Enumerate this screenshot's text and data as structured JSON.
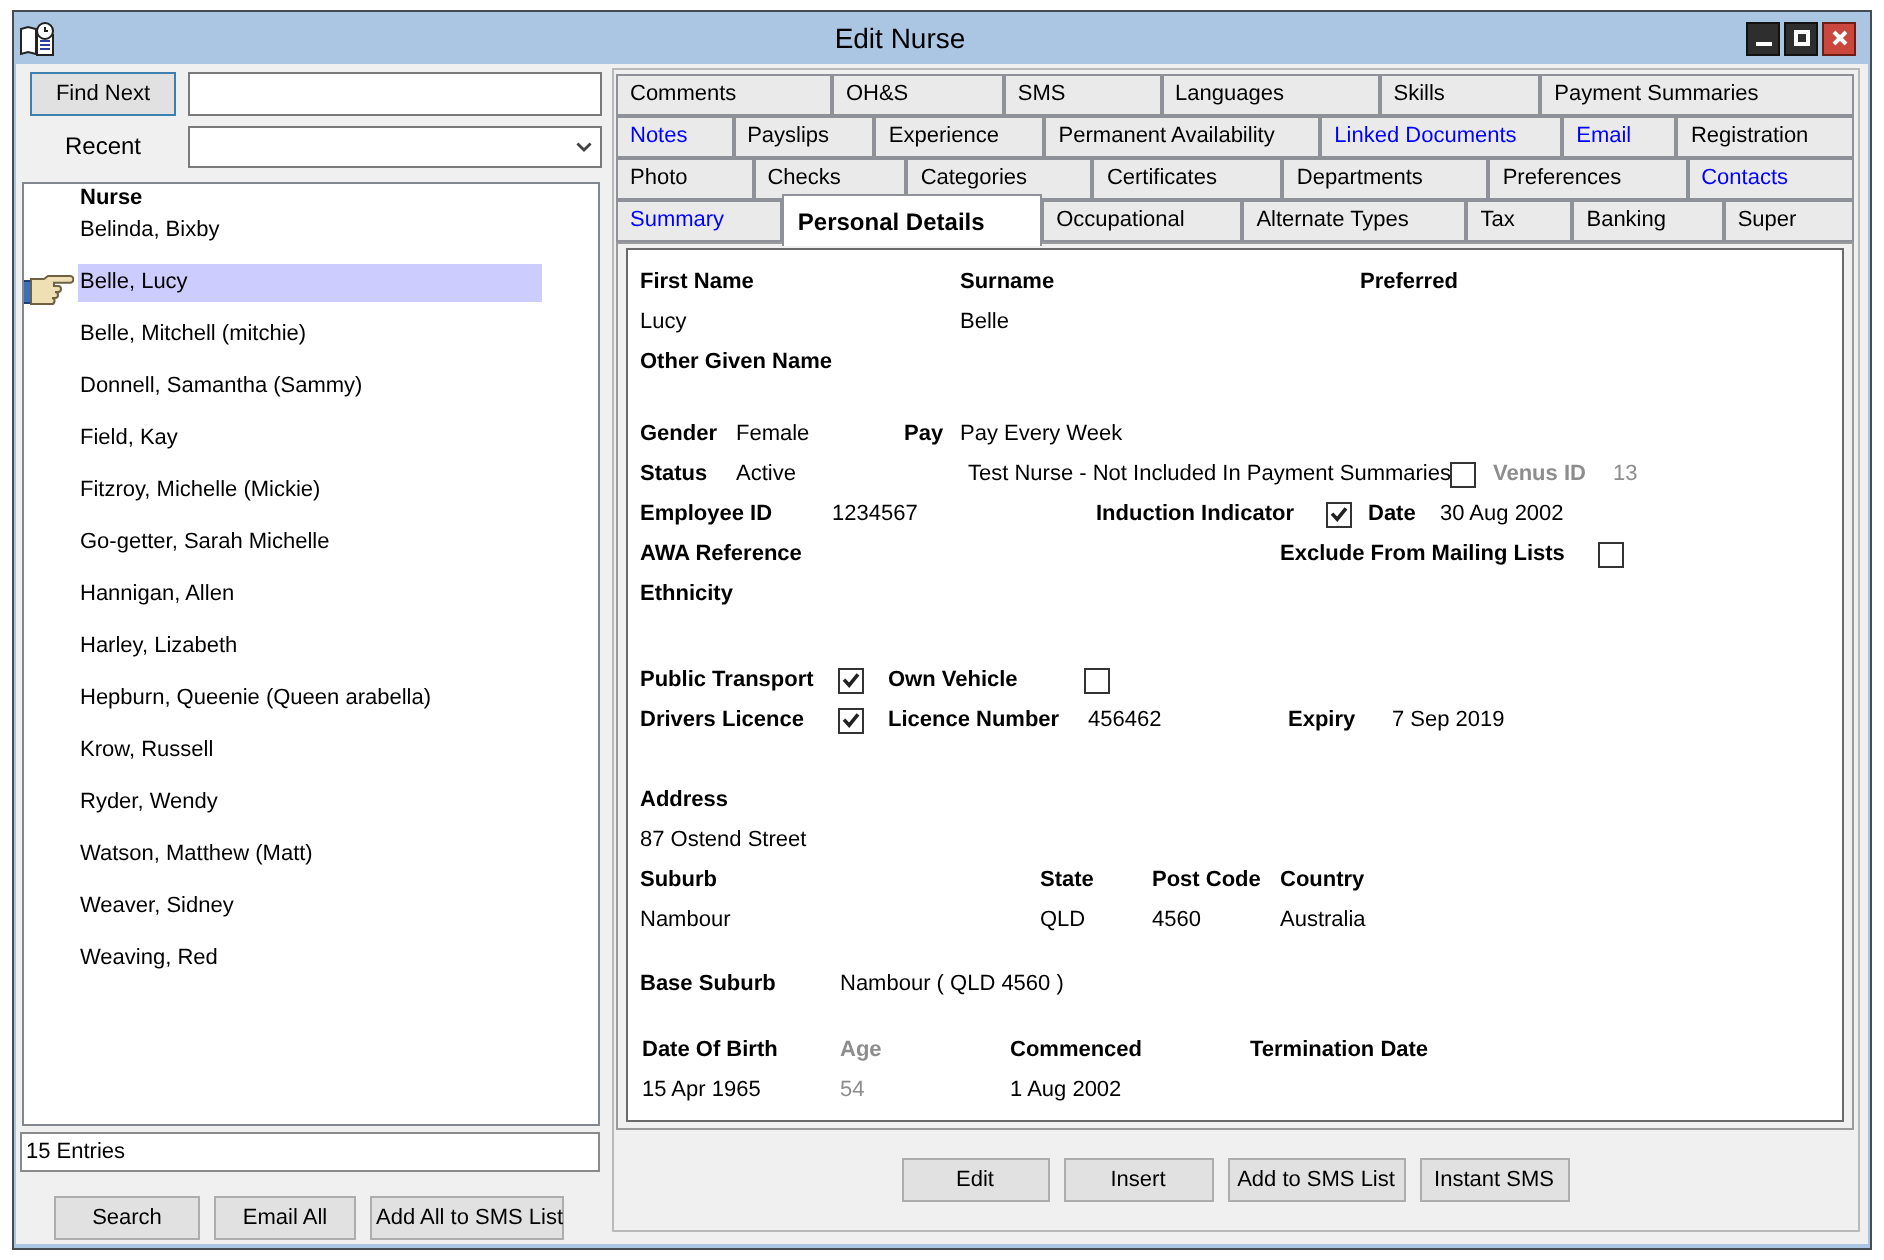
{
  "window": {
    "title": "Edit Nurse"
  },
  "search": {
    "find_button": "Find Next",
    "recent_label": "Recent"
  },
  "nurse_list": {
    "header": "Nurse",
    "items": [
      {
        "name": "Belinda, Bixby",
        "selected": false
      },
      {
        "name": "Belle, Lucy",
        "selected": true
      },
      {
        "name": "Belle, Mitchell (mitchie)",
        "selected": false
      },
      {
        "name": "Donnell, Samantha (Sammy)",
        "selected": false
      },
      {
        "name": "Field, Kay",
        "selected": false
      },
      {
        "name": "Fitzroy, Michelle (Mickie)",
        "selected": false
      },
      {
        "name": "Go-getter, Sarah Michelle",
        "selected": false
      },
      {
        "name": "Hannigan, Allen",
        "selected": false
      },
      {
        "name": "Harley, Lizabeth",
        "selected": false
      },
      {
        "name": "Hepburn, Queenie (Queen arabella)",
        "selected": false
      },
      {
        "name": "Krow, Russell",
        "selected": false
      },
      {
        "name": "Ryder, Wendy",
        "selected": false
      },
      {
        "name": "Watson, Matthew (Matt)",
        "selected": false
      },
      {
        "name": "Weaver, Sidney",
        "selected": false
      },
      {
        "name": "Weaving, Red",
        "selected": false
      }
    ]
  },
  "entry_count": "15 Entries",
  "list_buttons": [
    "Search",
    "Email All",
    "Add All to SMS List"
  ],
  "tabs": {
    "rows": [
      [
        {
          "label": "Comments",
          "selected": false,
          "highlighted": false
        },
        {
          "label": "OH&S",
          "selected": false,
          "highlighted": false
        },
        {
          "label": "SMS",
          "selected": false,
          "highlighted": false
        },
        {
          "label": "Languages",
          "selected": false,
          "highlighted": false
        },
        {
          "label": "Skills",
          "selected": false,
          "highlighted": false
        },
        {
          "label": "Payment Summaries",
          "selected": false,
          "highlighted": false
        }
      ],
      [
        {
          "label": "Notes",
          "selected": false,
          "highlighted": true
        },
        {
          "label": "Payslips",
          "selected": false,
          "highlighted": false
        },
        {
          "label": "Experience",
          "selected": false,
          "highlighted": false
        },
        {
          "label": "Permanent Availability",
          "selected": false,
          "highlighted": false
        },
        {
          "label": "Linked Documents",
          "selected": false,
          "highlighted": true
        },
        {
          "label": "Email",
          "selected": false,
          "highlighted": true
        },
        {
          "label": "Registration",
          "selected": false,
          "highlighted": false
        }
      ],
      [
        {
          "label": "Photo",
          "selected": false,
          "highlighted": false
        },
        {
          "label": "Checks",
          "selected": false,
          "highlighted": false
        },
        {
          "label": "Categories",
          "selected": false,
          "highlighted": false
        },
        {
          "label": "Certificates",
          "selected": false,
          "highlighted": false
        },
        {
          "label": "Departments",
          "selected": false,
          "highlighted": false
        },
        {
          "label": "Preferences",
          "selected": false,
          "highlighted": false
        },
        {
          "label": "Contacts",
          "selected": false,
          "highlighted": true
        }
      ],
      [
        {
          "label": "Summary",
          "selected": false,
          "highlighted": true
        },
        {
          "label": "Personal Details",
          "selected": true,
          "highlighted": false
        },
        {
          "label": "Occupational",
          "selected": false,
          "highlighted": false
        },
        {
          "label": "Alternate Types",
          "selected": false,
          "highlighted": false
        },
        {
          "label": "Tax",
          "selected": false,
          "highlighted": false
        },
        {
          "label": "Banking",
          "selected": false,
          "highlighted": false
        },
        {
          "label": "Super",
          "selected": false,
          "highlighted": false
        }
      ]
    ]
  },
  "personal_details": {
    "first_name": {
      "label": "First Name",
      "value": "Lucy"
    },
    "surname": {
      "label": "Surname",
      "value": "Belle"
    },
    "preferred": {
      "label": "Preferred"
    },
    "other_given_name": {
      "label": "Other Given Name"
    },
    "gender": {
      "label": "Gender",
      "value": "Female"
    },
    "pay": {
      "label": "Pay",
      "value": "Pay Every Week"
    },
    "status": {
      "label": "Status",
      "value": "Active"
    },
    "test_nurse": {
      "label": "Test Nurse - Not Included In Payment Summaries",
      "checked": false
    },
    "venus_id": {
      "label": "Venus ID",
      "value": "13",
      "disabled": true
    },
    "employee_id": {
      "label": "Employee ID",
      "value": "1234567"
    },
    "induction_indicator": {
      "label": "Induction Indicator",
      "checked": true
    },
    "induction_date": {
      "label": "Date",
      "value": "30 Aug 2002"
    },
    "awa_reference": {
      "label": "AWA Reference"
    },
    "exclude_from_mailing_lists": {
      "label": "Exclude From Mailing Lists",
      "checked": false
    },
    "ethnicity": {
      "label": "Ethnicity"
    },
    "public_transport": {
      "label": "Public Transport",
      "checked": true
    },
    "own_vehicle": {
      "label": "Own Vehicle",
      "checked": false
    },
    "drivers_licence": {
      "label": "Drivers Licence",
      "checked": true
    },
    "licence_number": {
      "label": "Licence Number",
      "value": "456462"
    },
    "expiry": {
      "label": "Expiry",
      "value": "7 Sep 2019"
    },
    "address": {
      "label": "Address",
      "value": "87 Ostend Street"
    },
    "suburb": {
      "label": "Suburb",
      "value": "Nambour"
    },
    "state": {
      "label": "State",
      "value": "QLD"
    },
    "post_code": {
      "label": "Post Code",
      "value": "4560"
    },
    "country": {
      "label": "Country",
      "value": "Australia"
    },
    "base_suburb": {
      "label": "Base Suburb",
      "value": "Nambour ( QLD 4560 )"
    },
    "date_of_birth": {
      "label": "Date Of Birth",
      "value": "15 Apr 1965"
    },
    "age": {
      "label": "Age",
      "value": "54",
      "disabled": true
    },
    "commenced": {
      "label": "Commenced",
      "value": "1 Aug 2002"
    },
    "termination_date": {
      "label": "Termination Date"
    }
  },
  "form_buttons": [
    "Edit",
    "Insert",
    "Add to SMS List",
    "Instant SMS"
  ]
}
